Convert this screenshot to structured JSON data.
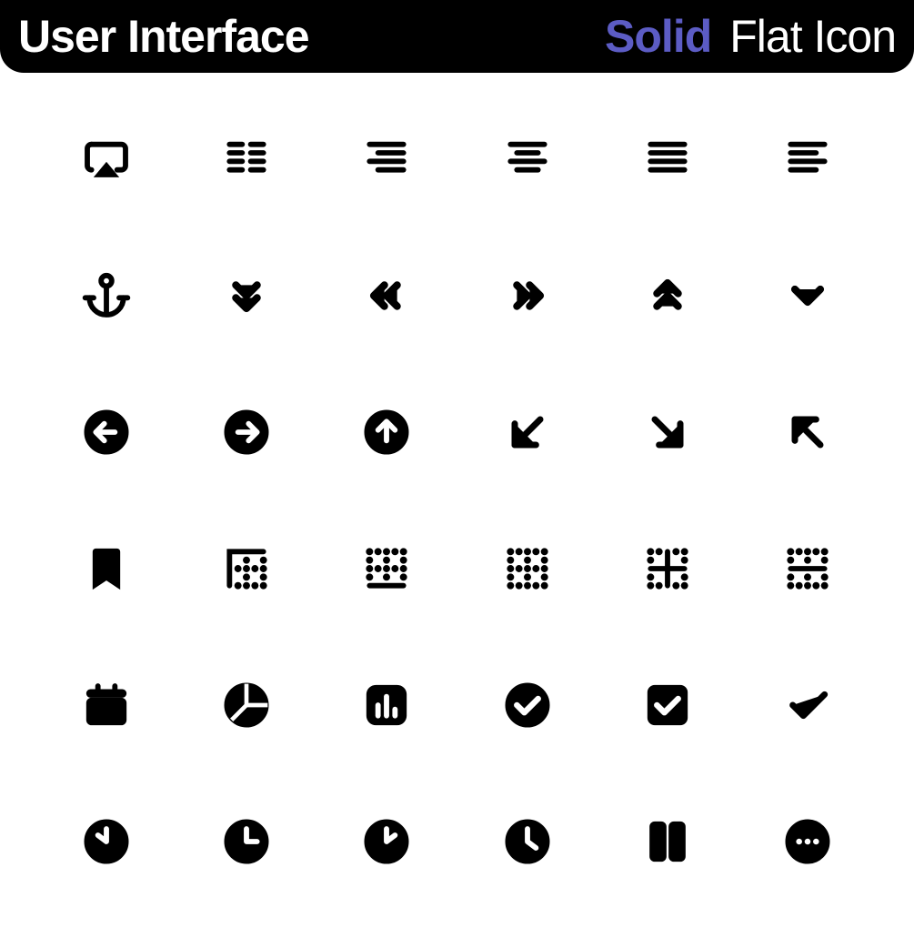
{
  "header": {
    "title": "User Interface",
    "solid": "Solid",
    "flat": "Flat Icon"
  },
  "icons": [
    {
      "name": "airplay-icon"
    },
    {
      "name": "columns-text-icon"
    },
    {
      "name": "align-right-icon"
    },
    {
      "name": "align-center-icon"
    },
    {
      "name": "align-justify-icon"
    },
    {
      "name": "align-left-icon"
    },
    {
      "name": "anchor-icon"
    },
    {
      "name": "chevrons-down-icon"
    },
    {
      "name": "chevrons-left-icon"
    },
    {
      "name": "chevrons-right-icon"
    },
    {
      "name": "chevrons-up-icon"
    },
    {
      "name": "chevron-down-icon"
    },
    {
      "name": "arrow-left-circle-icon"
    },
    {
      "name": "arrow-right-circle-icon"
    },
    {
      "name": "arrow-up-circle-icon"
    },
    {
      "name": "arrow-down-left-icon"
    },
    {
      "name": "arrow-down-right-icon"
    },
    {
      "name": "arrow-up-left-icon"
    },
    {
      "name": "bookmark-icon"
    },
    {
      "name": "border-top-left-icon"
    },
    {
      "name": "border-bottom-icon"
    },
    {
      "name": "border-none-icon"
    },
    {
      "name": "border-inner-icon"
    },
    {
      "name": "border-horizontal-icon"
    },
    {
      "name": "calendar-icon"
    },
    {
      "name": "pie-chart-icon"
    },
    {
      "name": "bar-chart-icon"
    },
    {
      "name": "check-circle-icon"
    },
    {
      "name": "check-square-icon"
    },
    {
      "name": "check-icon"
    },
    {
      "name": "clock-10-icon"
    },
    {
      "name": "clock-3-icon"
    },
    {
      "name": "clock-2-icon"
    },
    {
      "name": "clock-4-icon"
    },
    {
      "name": "columns-icon"
    },
    {
      "name": "message-circle-icon"
    }
  ]
}
